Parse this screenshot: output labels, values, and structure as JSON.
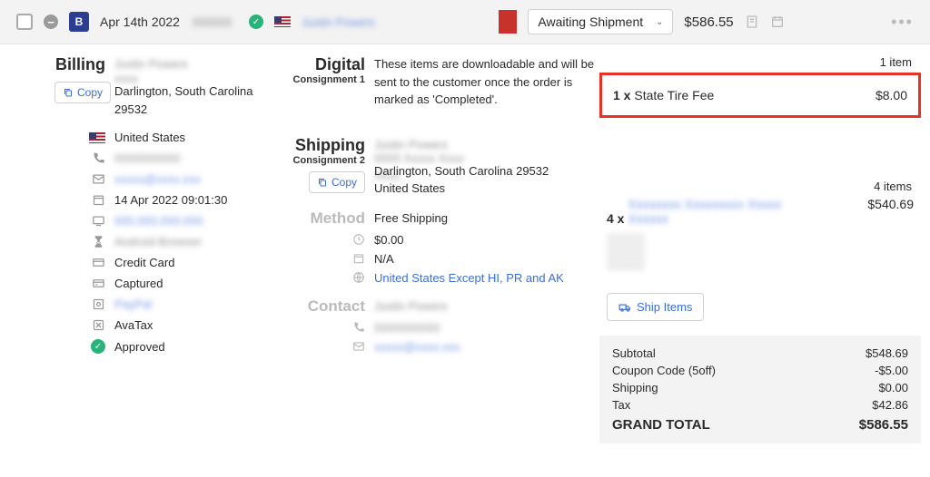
{
  "header": {
    "date": "Apr 14th 2022",
    "order_number": "000000",
    "customer_name": "Justin Powers",
    "status_label": "Awaiting Shipment",
    "total": "$586.55"
  },
  "billing": {
    "title": "Billing",
    "copy_label": "Copy",
    "name_line": "Justin Powers",
    "address_line": "Darlington, South Carolina 29532",
    "country": "United States",
    "phone": "0000000000",
    "email": "xxxxx@xxxx.xxx",
    "timestamp": "14 Apr 2022 09:01:30",
    "ip": "000.000.000.000",
    "device": "Android Browser",
    "payment_method": "Credit Card",
    "payment_status": "Captured",
    "gateway": "PayPal",
    "tax_provider": "AvaTax",
    "approval": "Approved"
  },
  "digital": {
    "title": "Digital",
    "sub": "Consignment 1",
    "note": "These items are downloadable and will be sent to the customer once the order is marked as 'Completed'.",
    "count_label": "1 item",
    "line_qty": "1 x",
    "line_name": "State Tire Fee",
    "line_price": "$8.00"
  },
  "shipping": {
    "title": "Shipping",
    "sub": "Consignment 2",
    "copy_label": "Copy",
    "name_line": "Justin Powers",
    "street": "0000 Xxxxx Xxxx Xxxx",
    "address_line": "Darlington, South Carolina 29532",
    "country": "United States",
    "method_title": "Method",
    "method_value": "Free Shipping",
    "cost": "$0.00",
    "date": "N/A",
    "zone": "United States Except HI, PR and AK",
    "contact_title": "Contact",
    "contact_name": "Justin Powers",
    "contact_phone": "0000000000",
    "contact_email": "xxxxx@xxxx.xxx",
    "count_label": "4 items",
    "line_qty": "4 x",
    "line_name": "Xxxxxxxx Xxxxxxxxx Xxxxx Xxxxxx",
    "line_price": "$540.69",
    "ship_btn": "Ship Items"
  },
  "totals": {
    "subtotal_label": "Subtotal",
    "subtotal": "$548.69",
    "coupon_label": "Coupon Code (5off)",
    "coupon": "-$5.00",
    "shipping_label": "Shipping",
    "shipping": "$0.00",
    "tax_label": "Tax",
    "tax": "$42.86",
    "grand_label": "GRAND TOTAL",
    "grand": "$586.55"
  }
}
